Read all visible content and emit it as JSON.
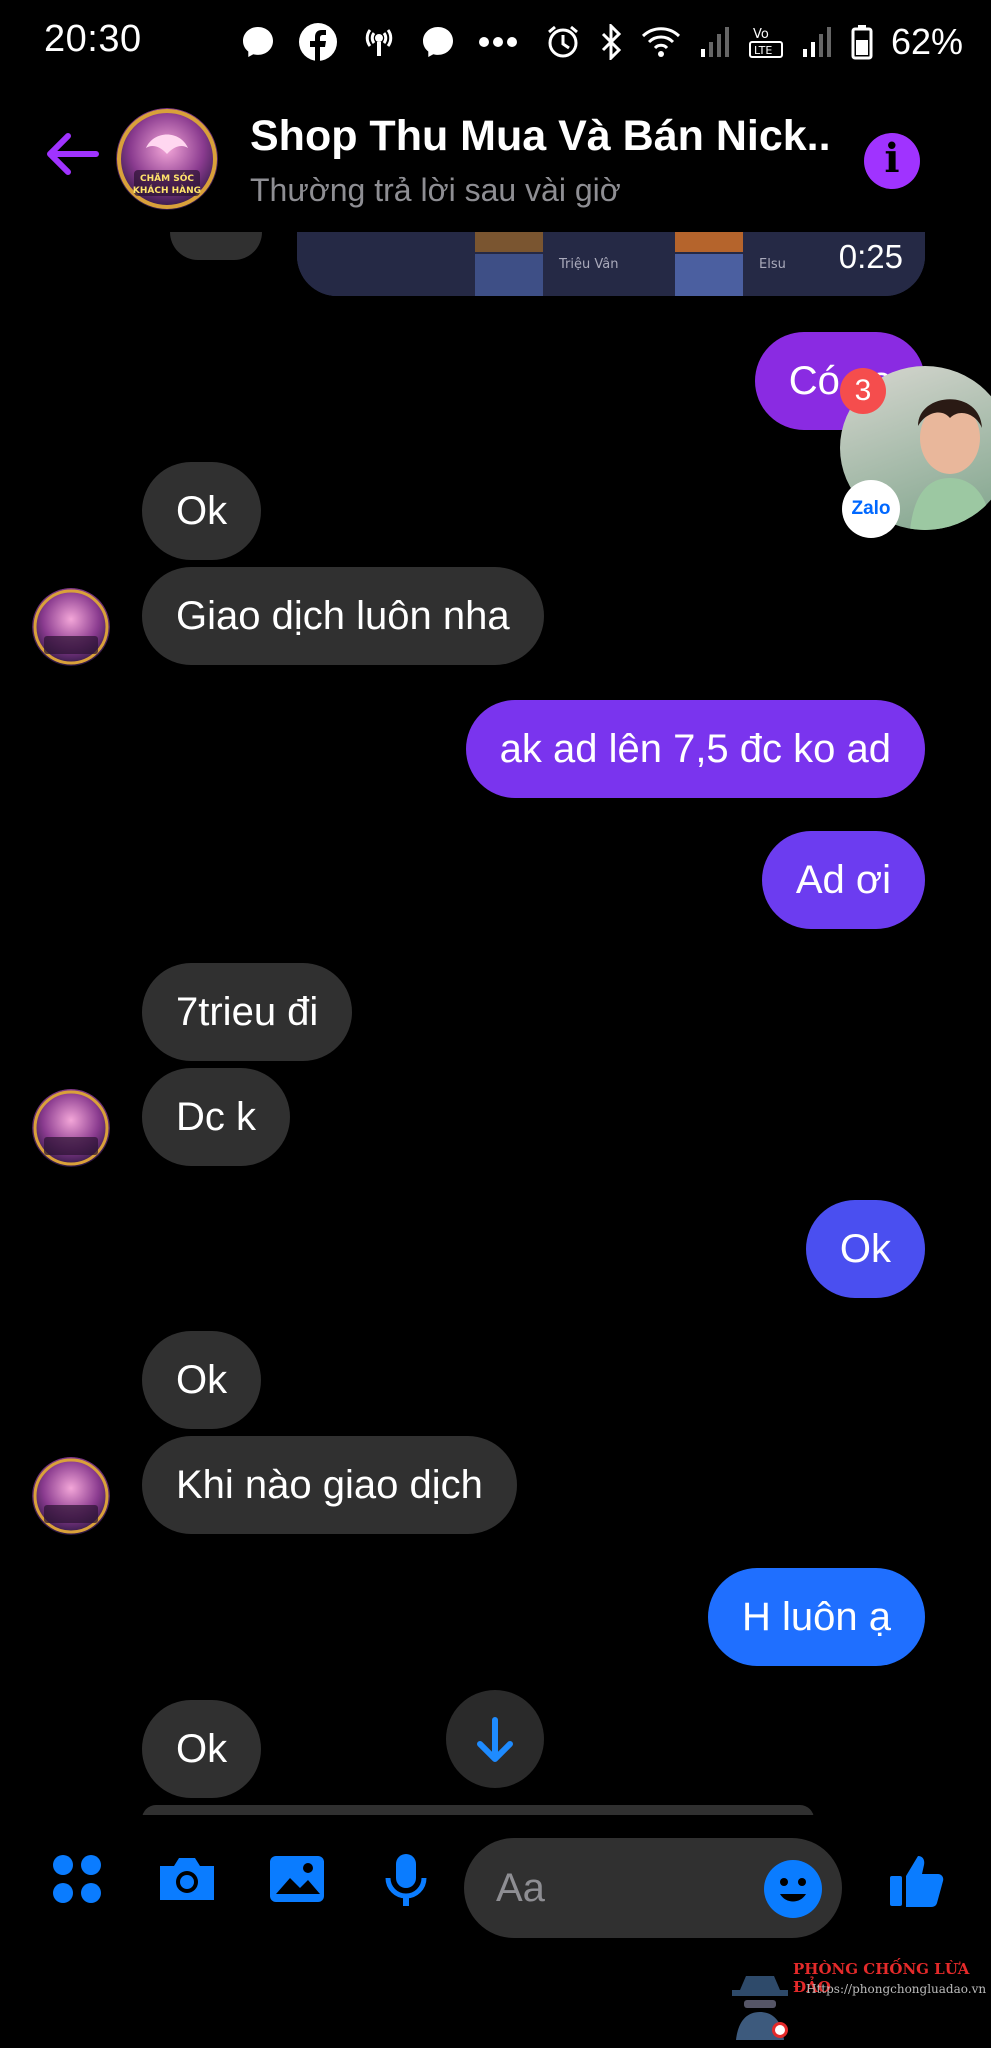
{
  "status_bar": {
    "time": "20:30",
    "battery": "62%",
    "left_icons": [
      "messenger-icon",
      "facebook-icon",
      "hotspot-icon",
      "messenger-icon",
      "more-dots-icon"
    ],
    "right_icons": [
      "alarm-icon",
      "bluetooth-icon",
      "wifi-icon",
      "signal-icon",
      "volte-icon",
      "signal-icon",
      "battery-icon"
    ]
  },
  "header": {
    "title": "Shop Thu Mua Và Bán Nick...",
    "subtitle": "Thường trả lời sau vài giờ",
    "avatar_text_line1": "CHĂM SÓC",
    "avatar_text_line2": "KHÁCH HÀNG"
  },
  "video_preview": {
    "duration": "0:25",
    "hero1": "Triệu Vân",
    "hero2": "Elsu"
  },
  "zalo_bubble": {
    "badge": "3",
    "logo_text": "Zalo"
  },
  "messages": [
    {
      "text": "Có ss",
      "side": "out"
    },
    {
      "text": "Ok",
      "side": "in"
    },
    {
      "text": "Giao dịch luôn nha",
      "side": "in"
    },
    {
      "text": "ak ad lên 7,5 đc ko ad",
      "side": "out"
    },
    {
      "text": "Ad ơi",
      "side": "out"
    },
    {
      "text": "7trieu đi",
      "side": "in"
    },
    {
      "text": "Dc k",
      "side": "in"
    },
    {
      "text": "Ok",
      "side": "out"
    },
    {
      "text": "Ok",
      "side": "in"
    },
    {
      "text": "Khi nào giao dịch",
      "side": "in"
    },
    {
      "text": "H luôn ạ",
      "side": "out"
    },
    {
      "text": "Ok",
      "side": "in"
    }
  ],
  "composer": {
    "placeholder": "Aa",
    "tools": [
      "apps-icon",
      "camera-icon",
      "gallery-icon",
      "mic-icon"
    ],
    "send_icon": "like-icon"
  },
  "watermark": {
    "title": "PHÒNG CHỐNG LỪA ĐẢO",
    "url": "Https://phongchongluadao.vn"
  },
  "colors": {
    "accent": "#a033ff",
    "out_purple": "#8a2be2",
    "out_blue": "#1f6fff",
    "incoming": "#303030",
    "background": "#000000"
  }
}
